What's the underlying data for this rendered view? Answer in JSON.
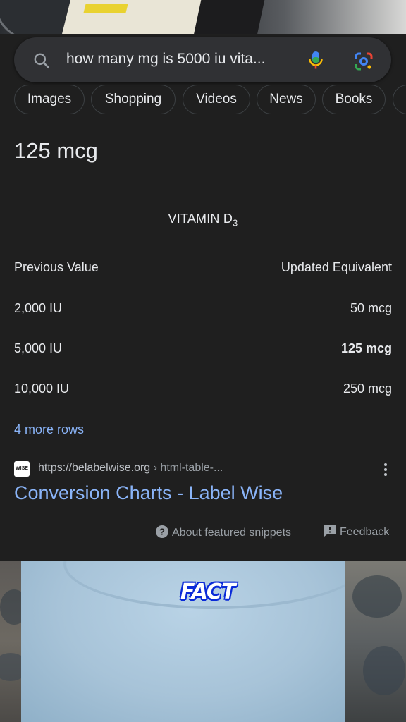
{
  "search": {
    "query": "how many mg is 5000 iu vita..."
  },
  "tabs": [
    {
      "label": "Images"
    },
    {
      "label": "Shopping"
    },
    {
      "label": "Videos"
    },
    {
      "label": "News"
    },
    {
      "label": "Books"
    }
  ],
  "answer": {
    "value": "125 mcg"
  },
  "table": {
    "title": "VITAMIN D",
    "title_subscript": "3",
    "headers": [
      "Previous Value",
      "Updated Equivalent"
    ],
    "rows": [
      {
        "previous": "2,000 IU",
        "updated": "50 mcg"
      },
      {
        "previous": "5,000 IU",
        "updated": "125 mcg"
      },
      {
        "previous": "10,000 IU",
        "updated": "250 mcg"
      }
    ],
    "more_rows": "4 more rows"
  },
  "source": {
    "favicon_text": "WISE",
    "url": "https://belabelwise.org",
    "breadcrumb": "› html-table-...",
    "title": "Conversion Charts - Label Wise"
  },
  "footer": {
    "about": "About featured snippets",
    "feedback": "Feedback"
  },
  "overlay": {
    "caption": "FACT"
  },
  "colors": {
    "background": "#1f1f1f",
    "link": "#8ab4f8",
    "caption_outline": "#0b2bd8"
  }
}
